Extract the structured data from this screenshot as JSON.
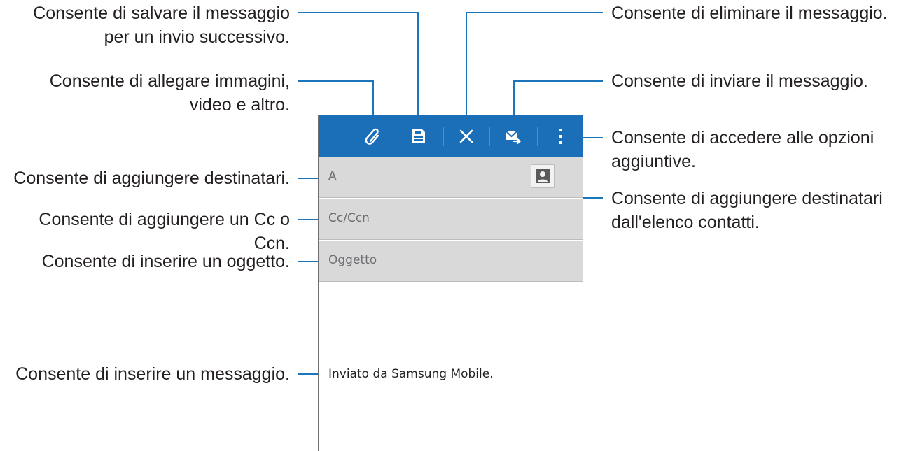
{
  "toolbar": {
    "icons": [
      "paperclip-icon",
      "save-icon",
      "close-icon",
      "send-mail-icon",
      "more-vert-icon"
    ],
    "background_color": "#1b6fb9"
  },
  "fields": {
    "to_label": "A",
    "cc_label": "Cc/Ccn",
    "subject_label": "Oggetto"
  },
  "body": {
    "signature": "Inviato da Samsung Mobile."
  },
  "callouts": {
    "save": [
      "Consente di salvare il messaggio",
      "per un invio successivo."
    ],
    "attach": [
      "Consente di allegare immagini,",
      "video e altro."
    ],
    "recipients": [
      "Consente di aggiungere destinatari."
    ],
    "cc": [
      "Consente di aggiungere un Cc o",
      "Ccn."
    ],
    "subject": [
      "Consente di inserire un oggetto."
    ],
    "message": [
      "Consente di inserire un messaggio."
    ],
    "delete": [
      "Consente di eliminare il messaggio."
    ],
    "send": [
      "Consente di inviare il messaggio."
    ],
    "options": [
      "Consente di accedere alle opzioni",
      "aggiuntive."
    ],
    "contacts": [
      "Consente di aggiungere destinatari",
      "dall'elenco contatti."
    ]
  },
  "accent_color": "#1b75bb"
}
